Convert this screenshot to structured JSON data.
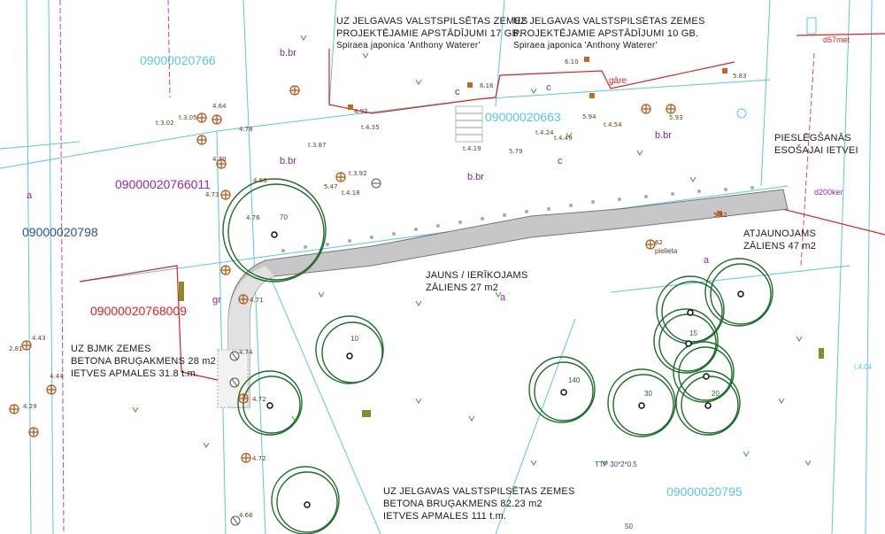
{
  "notes": {
    "n1": [
      "UZ JELGAVAS VALSTSPILSĒTAS ZEMES",
      "PROJEKTĒJAMIE APSTĀDĪJUMI 17 GB.",
      "Spiraea japonica 'Anthony Waterer'"
    ],
    "n2": [
      "UZ JELGAVAS VALSTSPILSĒTAS ZEMES",
      "PROJEKTĒJAMIE APSTĀDĪJUMI 10 GB.",
      "Spiraea japonica 'Anthony Waterer'"
    ],
    "n3": [
      "PIESLĒGŠANĀS",
      "ESOŠAJAI IETVEI"
    ],
    "n4": [
      "ATJAUNOJAMS",
      "ZĀLIENS 47 m2"
    ],
    "n5": [
      "JAUNS / IERĪKOJAMS",
      "ZĀLIENS 27 m2"
    ],
    "n6": [
      "UZ BJMK ZEMES",
      "BETONA BRUĢAKMENS 28 m2",
      "IETVES APMALES 31.8 t.m."
    ],
    "n7": [
      "UZ JELGAVAS VALSTSPILSĒTAS ZEMES",
      "BETONA BRUĢAKMENS 82.23 m2",
      "IETVES APMALES 111 t.m."
    ]
  },
  "cadastral": {
    "c1": "09000020766",
    "c2": "09000020663",
    "c3": "09000020766011",
    "c4": "09000020798",
    "c5": "09000020768009",
    "c6": "09000020795"
  },
  "colors": {
    "cadastral_cyan": "#5bc8d6",
    "cadastral_purple": "#9a2aa0",
    "cadastral_blue": "#2b4fa0",
    "cadastral_red": "#e02020",
    "tree_green": "#1f6b2a",
    "pavement_grey": "#8a8a8a",
    "survey_brown": "#b35a1a"
  },
  "tags": {
    "bbr1": "b.br",
    "bbr2": "b.br",
    "bbr3": "b.br",
    "bbr4": "b.br",
    "c1": "c",
    "c2": "c",
    "c3": "c",
    "a1": "a",
    "a2": "a",
    "a3": "a",
    "gr": "gr",
    "gare": "gāre",
    "pielieta": "pielieta",
    "t404": "t.4.04",
    "d57met": "d57met",
    "d200ker": "d200ker",
    "ttp": "TTP 30*2*0.5"
  },
  "trees": {
    "t70": "70",
    "t10": "10",
    "t140": "140",
    "t30": "30",
    "t15": "15",
    "t20": "20",
    "t50": "50"
  },
  "survey": {
    "s1": "4.92",
    "s2": "5.47",
    "s3": "5.94",
    "s4": "5.93",
    "s5": "5.79",
    "s6": "4.71",
    "s7": "4.72",
    "s8": "4.72",
    "s9": "4.66",
    "s10": "4.74",
    "s11": "4.43",
    "s12": "4.44",
    "s13": "6.16",
    "s14": "6.10",
    "s15": "5.83",
    "s16": "t.3.92",
    "s17": "t.4.24",
    "s18": "t.4.49",
    "s19": "t.4.54",
    "s20": "t.4.19",
    "s21": "t.3.87",
    "s22": "t.4.35",
    "s23": "t.4.18",
    "s24": "5.32",
    "s25": "62",
    "s26": "t.3.02",
    "s27": "t.3.05",
    "s28": "4.64",
    "s29": "4.78",
    "s30": "4.70",
    "s31": "4.73",
    "s32": "4.76",
    "s33": "4.68",
    "s34": "2.81",
    "s35": "4.29"
  }
}
